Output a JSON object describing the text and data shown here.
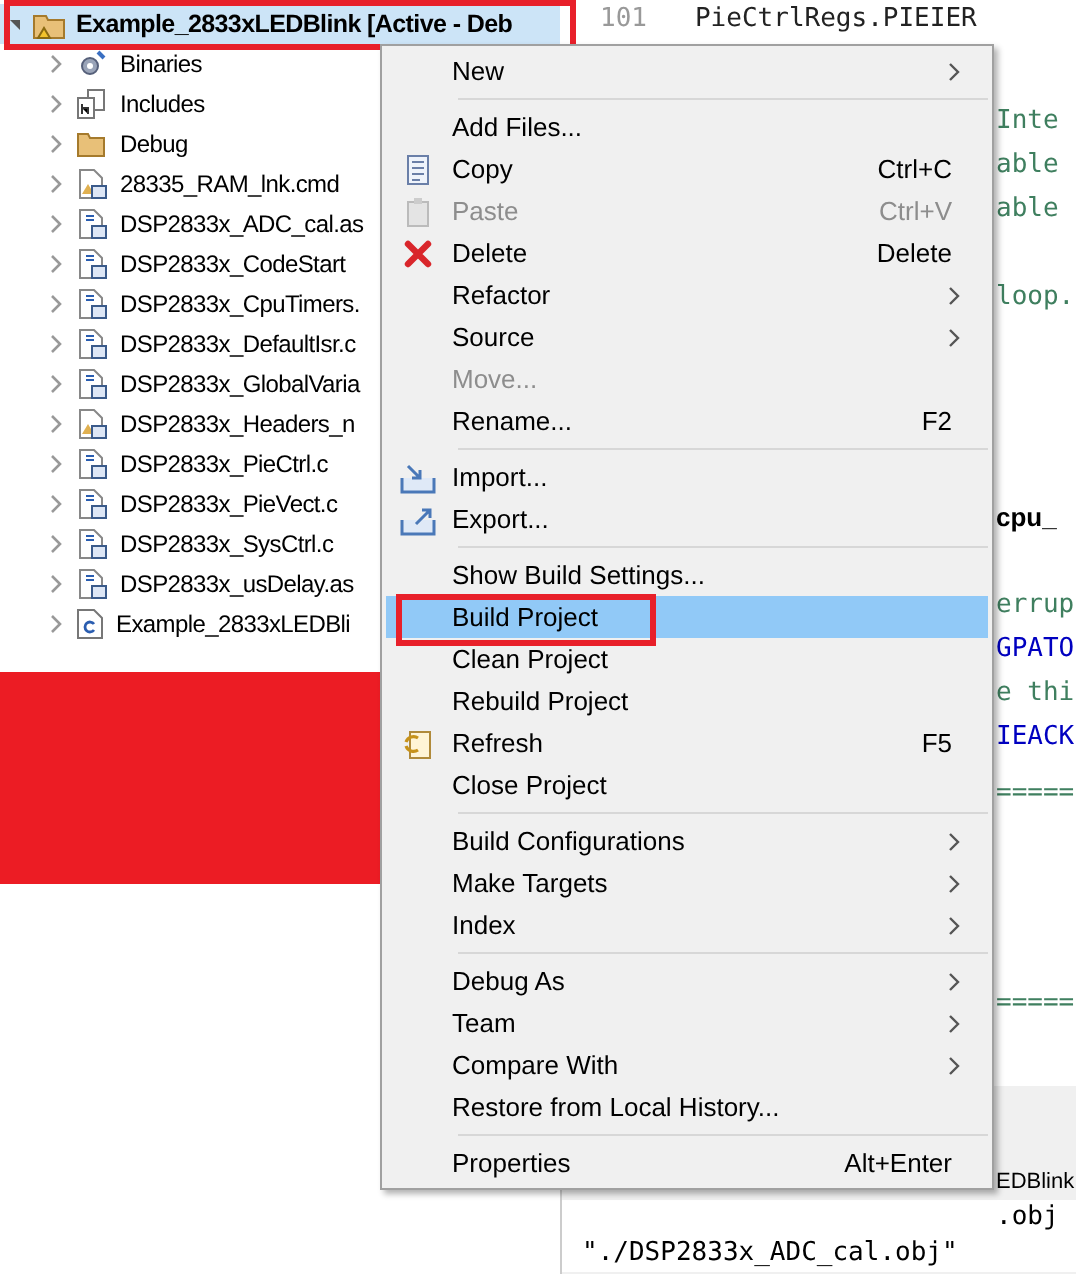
{
  "project_tree": {
    "title": "Example_2833xLEDBlink [Active - Deb",
    "expanded": true,
    "selected": true,
    "children": [
      {
        "label": "Binaries",
        "kind": "binaries"
      },
      {
        "label": "Includes",
        "kind": "includes"
      },
      {
        "label": "Debug",
        "kind": "folder"
      },
      {
        "label": "28335_RAM_lnk.cmd",
        "kind": "cmd"
      },
      {
        "label": "DSP2833x_ADC_cal.as",
        "kind": "source"
      },
      {
        "label": "DSP2833x_CodeStart",
        "kind": "source"
      },
      {
        "label": "DSP2833x_CpuTimers.",
        "kind": "source"
      },
      {
        "label": "DSP2833x_DefaultIsr.c",
        "kind": "source"
      },
      {
        "label": "DSP2833x_GlobalVaria",
        "kind": "source"
      },
      {
        "label": "DSP2833x_Headers_n",
        "kind": "cmd"
      },
      {
        "label": "DSP2833x_PieCtrl.c",
        "kind": "source"
      },
      {
        "label": "DSP2833x_PieVect.c",
        "kind": "source"
      },
      {
        "label": "DSP2833x_SysCtrl.c",
        "kind": "source"
      },
      {
        "label": "DSP2833x_usDelay.as",
        "kind": "source"
      },
      {
        "label": "Example_2833xLEDBli",
        "kind": "c"
      }
    ]
  },
  "editor": {
    "line_number": "101",
    "first_line": "PieCtrlRegs.PIEIER",
    "fragments": [
      {
        "text": "Inte",
        "kind": "comment"
      },
      {
        "text": "able",
        "kind": "comment"
      },
      {
        "text": "able",
        "kind": "comment"
      },
      {
        "text": "loop.",
        "kind": "comment"
      },
      {
        "text": "cpu_",
        "kind": "bold"
      },
      {
        "text": "errup",
        "kind": "comment"
      },
      {
        "text": "GPATO",
        "kind": "code"
      },
      {
        "text": "e thi",
        "kind": "comment"
      },
      {
        "text": "IEACK",
        "kind": "code"
      },
      {
        "text": "=====",
        "kind": "comment"
      },
      {
        "text": "=====",
        "kind": "comment"
      }
    ]
  },
  "console": {
    "tab_fragment": "EDBlink",
    "lines": [
      ".obj",
      "\"./DSP2833x_ADC_cal.obj\""
    ]
  },
  "context_menu": {
    "items": [
      {
        "kind": "item",
        "label": "New",
        "submenu": true,
        "disabled": false,
        "selected": false
      },
      {
        "kind": "separator"
      },
      {
        "kind": "item",
        "label": "Add Files...",
        "submenu": false,
        "disabled": false,
        "selected": false
      },
      {
        "kind": "item",
        "label": "Copy",
        "shortcut": "Ctrl+C",
        "submenu": false,
        "disabled": false,
        "selected": false
      },
      {
        "kind": "item",
        "label": "Paste",
        "shortcut": "Ctrl+V",
        "submenu": false,
        "disabled": true,
        "selected": false
      },
      {
        "kind": "item",
        "label": "Delete",
        "shortcut": "Delete",
        "submenu": false,
        "disabled": false,
        "selected": false
      },
      {
        "kind": "item",
        "label": "Refactor",
        "submenu": true,
        "disabled": false,
        "selected": false
      },
      {
        "kind": "item",
        "label": "Source",
        "submenu": true,
        "disabled": false,
        "selected": false
      },
      {
        "kind": "item",
        "label": "Move...",
        "submenu": false,
        "disabled": true,
        "selected": false
      },
      {
        "kind": "item",
        "label": "Rename...",
        "shortcut": "F2",
        "submenu": false,
        "disabled": false,
        "selected": false
      },
      {
        "kind": "separator"
      },
      {
        "kind": "item",
        "label": "Import...",
        "submenu": false,
        "disabled": false,
        "selected": false
      },
      {
        "kind": "item",
        "label": "Export...",
        "submenu": false,
        "disabled": false,
        "selected": false
      },
      {
        "kind": "separator"
      },
      {
        "kind": "item",
        "label": "Show Build Settings...",
        "submenu": false,
        "disabled": false,
        "selected": false
      },
      {
        "kind": "item",
        "label": "Build Project",
        "submenu": false,
        "disabled": false,
        "selected": true
      },
      {
        "kind": "item",
        "label": "Clean Project",
        "submenu": false,
        "disabled": false,
        "selected": false
      },
      {
        "kind": "item",
        "label": "Rebuild Project",
        "submenu": false,
        "disabled": false,
        "selected": false
      },
      {
        "kind": "item",
        "label": "Refresh",
        "shortcut": "F5",
        "submenu": false,
        "disabled": false,
        "selected": false
      },
      {
        "kind": "item",
        "label": "Close Project",
        "submenu": false,
        "disabled": false,
        "selected": false
      },
      {
        "kind": "separator"
      },
      {
        "kind": "item",
        "label": "Build Configurations",
        "submenu": true,
        "disabled": false,
        "selected": false
      },
      {
        "kind": "item",
        "label": "Make Targets",
        "submenu": true,
        "disabled": false,
        "selected": false
      },
      {
        "kind": "item",
        "label": "Index",
        "submenu": true,
        "disabled": false,
        "selected": false
      },
      {
        "kind": "separator"
      },
      {
        "kind": "item",
        "label": "Debug As",
        "submenu": true,
        "disabled": false,
        "selected": false
      },
      {
        "kind": "item",
        "label": "Team",
        "submenu": true,
        "disabled": false,
        "selected": false
      },
      {
        "kind": "item",
        "label": "Compare With",
        "submenu": true,
        "disabled": false,
        "selected": false
      },
      {
        "kind": "item",
        "label": "Restore from Local History...",
        "submenu": false,
        "disabled": false,
        "selected": false
      },
      {
        "kind": "separator"
      },
      {
        "kind": "item",
        "label": "Properties",
        "shortcut": "Alt+Enter",
        "submenu": false,
        "disabled": false,
        "selected": false
      }
    ]
  }
}
